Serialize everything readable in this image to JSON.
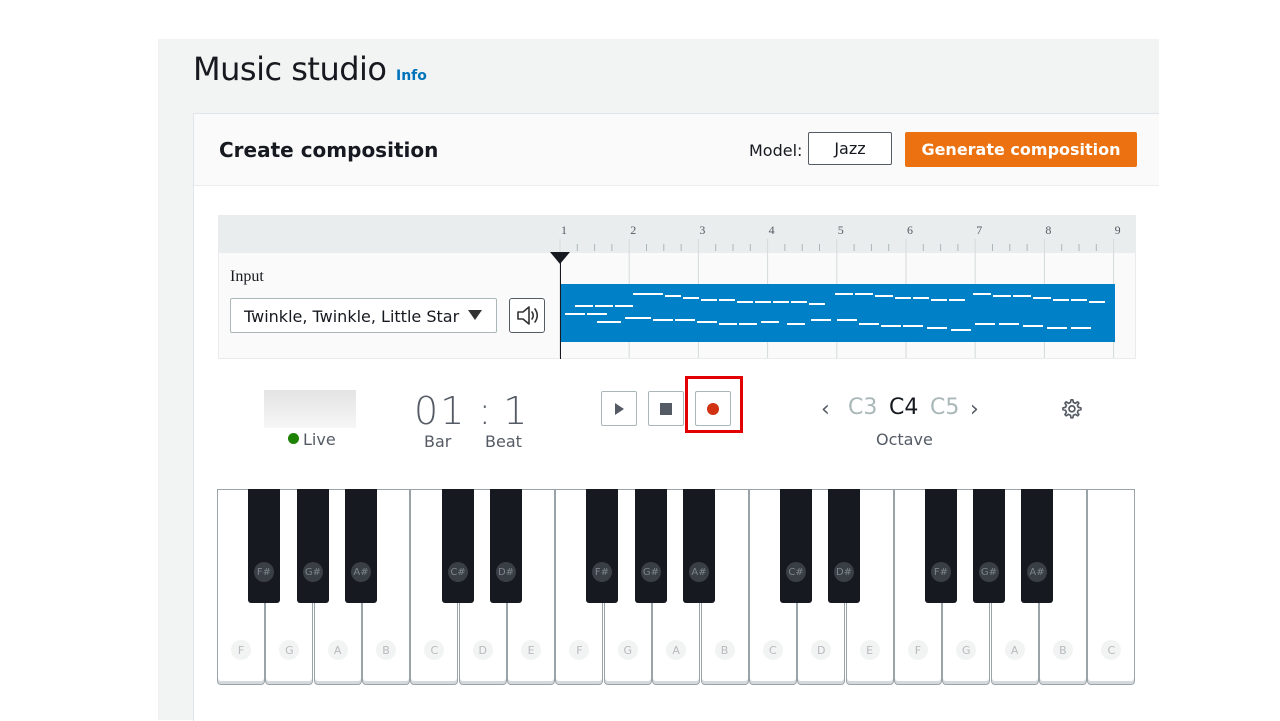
{
  "header": {
    "title": "Music studio",
    "info_link": "Info"
  },
  "composition": {
    "title": "Create composition",
    "model_label": "Model:",
    "model_value": "Jazz",
    "generate_label": "Generate composition"
  },
  "timeline": {
    "bars": [
      "1",
      "2",
      "3",
      "4",
      "5",
      "6",
      "7",
      "8",
      "9"
    ],
    "input_label": "Input",
    "input_value": "Twinkle, Twinkle, Little Star",
    "lane_color": "#0080c6"
  },
  "transport": {
    "live_label": "Live",
    "live_color": "#1d8102",
    "bar": "01",
    "beat": "1",
    "bar_label": "Bar",
    "beat_label": "Beat",
    "record_color": "#d13212"
  },
  "octave": {
    "options": [
      "C3",
      "C4",
      "C5"
    ],
    "selected": "C4",
    "label": "Octave"
  },
  "piano": {
    "white_keys": [
      "F",
      "G",
      "A",
      "B",
      "C",
      "D",
      "E",
      "F",
      "G",
      "A",
      "B",
      "C",
      "D",
      "E",
      "F",
      "G",
      "A",
      "B",
      "C"
    ],
    "black_keys": [
      "F#",
      "G#",
      "A#",
      "C#",
      "D#",
      "F#",
      "G#",
      "A#",
      "C#",
      "D#",
      "F#",
      "G#",
      "A#"
    ]
  },
  "highlight_color": "#e20000"
}
